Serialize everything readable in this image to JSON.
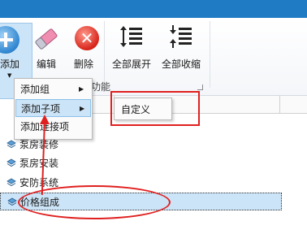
{
  "ribbon": {
    "buttons": {
      "add": "添加",
      "edit": "编辑",
      "delete": "删除",
      "expand_all": "全部展开",
      "collapse_all": "全部收缩"
    },
    "group_label": "功能"
  },
  "context_menu": {
    "items": [
      {
        "label": "添加组",
        "has_submenu": true
      },
      {
        "label": "添加子项",
        "has_submenu": true
      },
      {
        "label": "添加连接项",
        "has_submenu": false
      }
    ]
  },
  "submenu": {
    "items": [
      {
        "label": "自定义"
      }
    ]
  },
  "tree": {
    "items": [
      {
        "label": "泵房装修"
      },
      {
        "label": "泵房安装"
      },
      {
        "label": "安防系统"
      },
      {
        "label": "价格组成",
        "selected": true
      }
    ]
  },
  "colors": {
    "titlebar": "#1e7bc4",
    "highlight": "#cce4f7",
    "annotation_red": "#e02020",
    "accent_blue": "#2f86d0",
    "delete_red": "#d8241a"
  },
  "icons": {
    "add": "add-circle-icon",
    "edit": "eraser-icon",
    "delete": "delete-x-icon",
    "expand_all": "expand-list-icon",
    "collapse_all": "collapse-list-icon",
    "tree_node": "stack-layers-icon"
  }
}
